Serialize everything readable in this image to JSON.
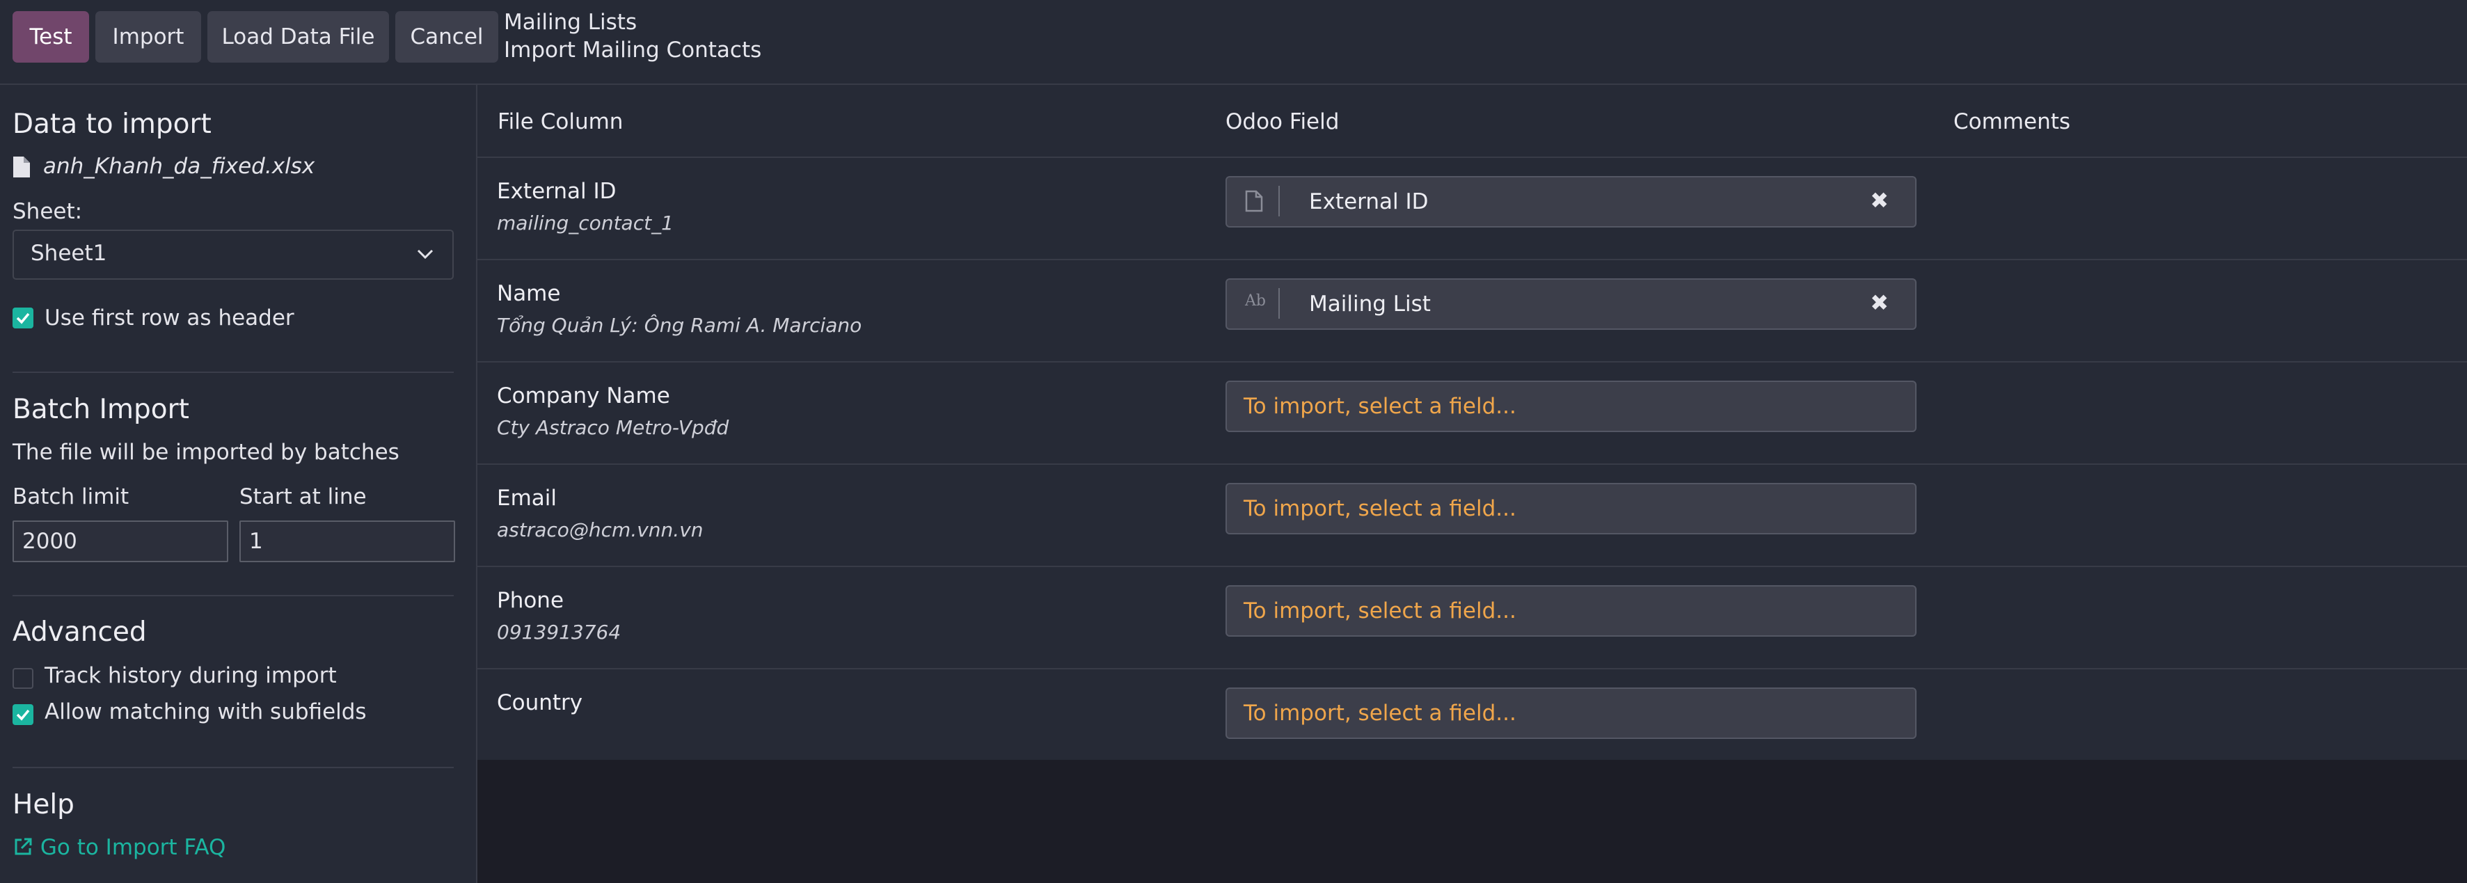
{
  "toolbar": {
    "test": "Test",
    "import": "Import",
    "load": "Load Data File",
    "cancel": "Cancel"
  },
  "breadcrumb": {
    "parent": "Mailing Lists",
    "current": "Import Mailing Contacts"
  },
  "sidebar": {
    "data_title": "Data to import",
    "file_name": "anh_Khanh_da_fixed.xlsx",
    "sheet_label": "Sheet:",
    "sheet_value": "Sheet1",
    "header_checkbox": "Use first row as header",
    "batch_title": "Batch Import",
    "batch_desc": "The file will be imported by batches",
    "batch_limit_label": "Batch limit",
    "batch_limit_value": "2000",
    "start_line_label": "Start at line",
    "start_line_value": "1",
    "advanced_title": "Advanced",
    "track_history": "Track history during import",
    "allow_matching": "Allow matching with subfields",
    "help_title": "Help",
    "faq_link": "Go to Import FAQ"
  },
  "table": {
    "headers": {
      "file_column": "File Column",
      "odoo_field": "Odoo Field",
      "comments": "Comments"
    },
    "placeholder": "To import, select a field...",
    "rows": [
      {
        "column": "External ID",
        "sample": "mailing_contact_1",
        "field": "External ID",
        "icon": "file-icon"
      },
      {
        "column": "Name",
        "sample": "Tổng Quản Lý: Ông Rami A. Marciano",
        "field": "Mailing List",
        "icon": "text-icon"
      },
      {
        "column": "Company Name",
        "sample": "Cty Astraco Metro-Vpđd",
        "field": ""
      },
      {
        "column": "Email",
        "sample": "astraco@hcm.vnn.vn",
        "field": ""
      },
      {
        "column": "Phone",
        "sample": "0913913764",
        "field": ""
      },
      {
        "column": "Country",
        "sample": "",
        "field": ""
      }
    ]
  },
  "colors": {
    "primary": "#71466b",
    "accent": "#1bb5a0",
    "placeholder": "#f0a64b"
  }
}
